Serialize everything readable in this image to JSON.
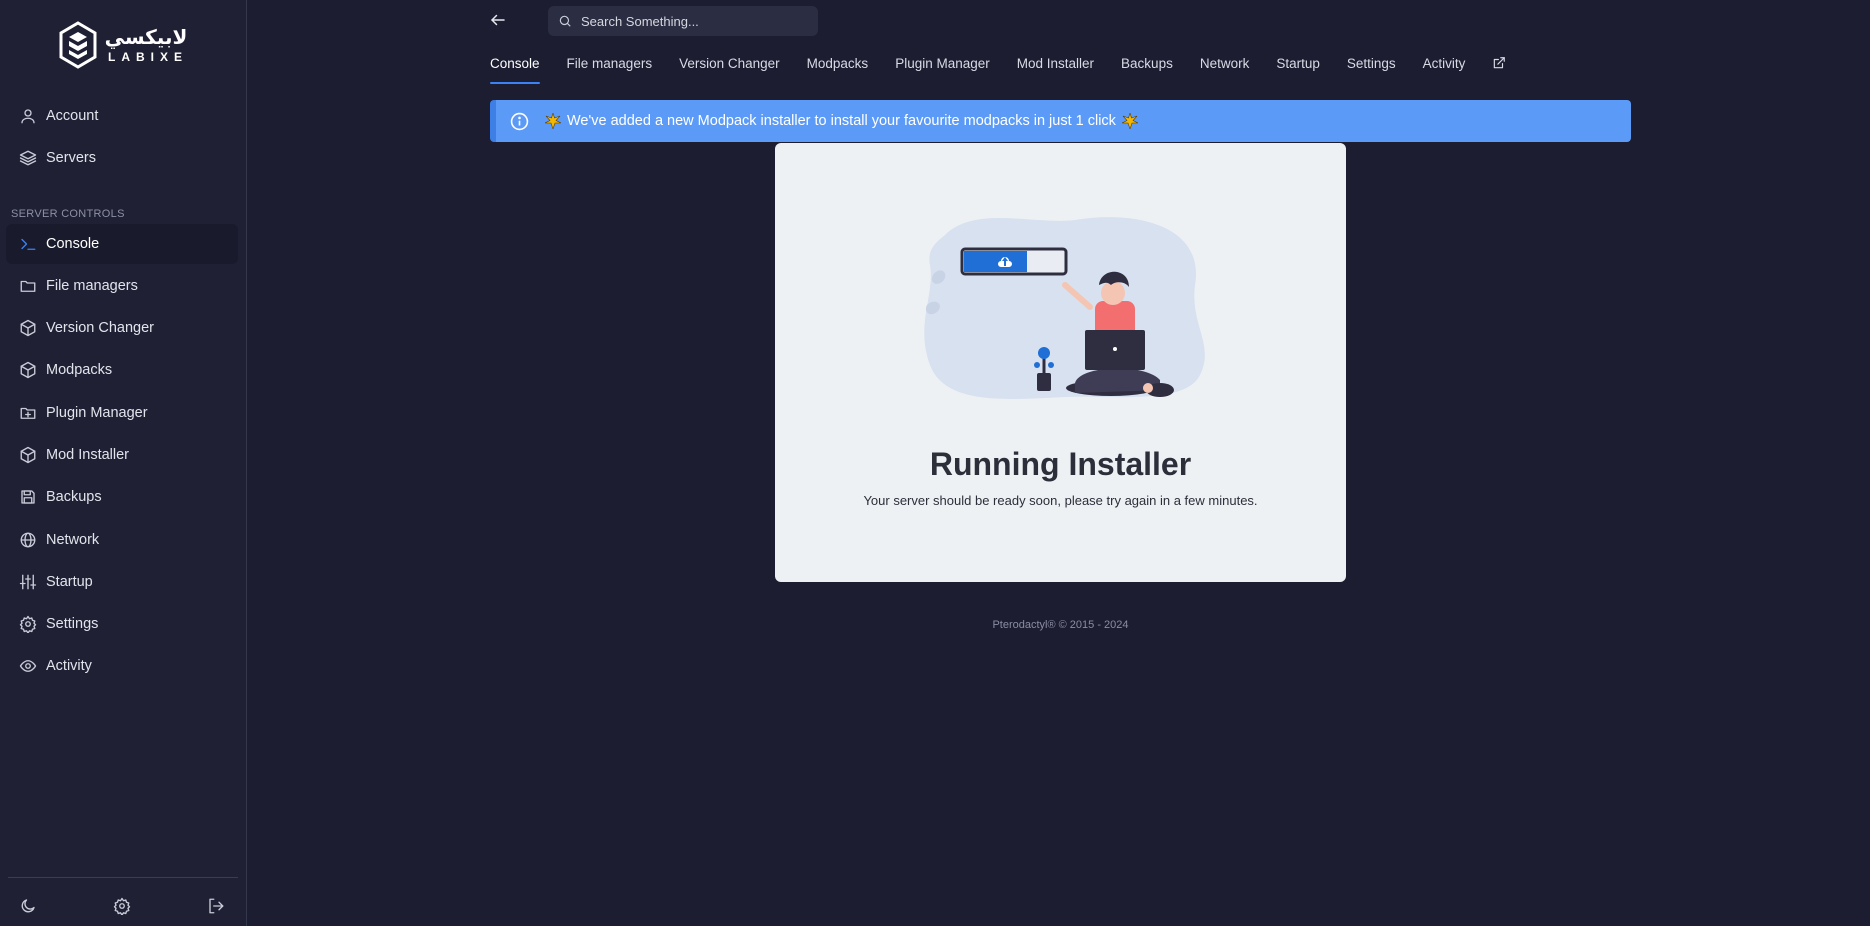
{
  "brand": {
    "arabic_name": "لابيكسي",
    "latin_name": "LABIXE"
  },
  "sidebar": {
    "top_items": [
      {
        "label": "Account",
        "icon": "user-icon"
      },
      {
        "label": "Servers",
        "icon": "layers-icon"
      }
    ],
    "section_label": "SERVER CONTROLS",
    "items": [
      {
        "label": "Console",
        "icon": "terminal-icon",
        "active": true
      },
      {
        "label": "File managers",
        "icon": "folder-icon"
      },
      {
        "label": "Version Changer",
        "icon": "box-icon"
      },
      {
        "label": "Modpacks",
        "icon": "box-icon"
      },
      {
        "label": "Plugin Manager",
        "icon": "folder-plus-icon"
      },
      {
        "label": "Mod Installer",
        "icon": "box-icon"
      },
      {
        "label": "Backups",
        "icon": "save-icon"
      },
      {
        "label": "Network",
        "icon": "globe-icon"
      },
      {
        "label": "Startup",
        "icon": "sliders-icon"
      },
      {
        "label": "Settings",
        "icon": "gear-icon"
      },
      {
        "label": "Activity",
        "icon": "eye-icon"
      }
    ],
    "bottom_icons": [
      "moon-icon",
      "gear-icon",
      "logout-icon"
    ]
  },
  "search": {
    "placeholder": "Search Something..."
  },
  "tabs": [
    {
      "label": "Console",
      "active": true
    },
    {
      "label": "File managers"
    },
    {
      "label": "Version Changer"
    },
    {
      "label": "Modpacks"
    },
    {
      "label": "Plugin Manager"
    },
    {
      "label": "Mod Installer"
    },
    {
      "label": "Backups"
    },
    {
      "label": "Network"
    },
    {
      "label": "Startup"
    },
    {
      "label": "Settings"
    },
    {
      "label": "Activity"
    }
  ],
  "alert": {
    "message": "We've added a new Modpack installer to install your favourite modpacks in just 1 click",
    "color": "#5b9bf7"
  },
  "status_card": {
    "title": "Running Installer",
    "subtitle": "Your server should be ready soon, please try again in a few minutes."
  },
  "footer": {
    "text": "Pterodactyl® © 2015 - 2024"
  },
  "colors": {
    "background": "#1c1d31",
    "sidebar": "#1f2034",
    "accent": "#3b82f6"
  }
}
